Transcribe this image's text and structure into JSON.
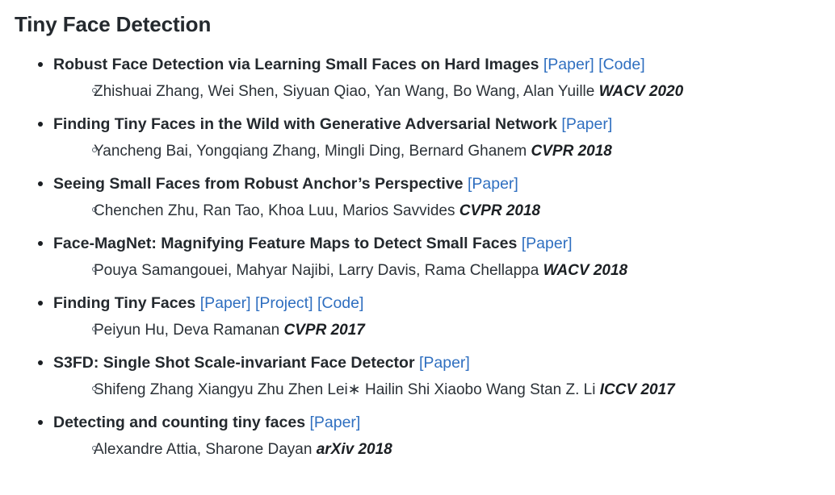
{
  "heading": "Tiny Face Detection",
  "colors": {
    "link": "#2f6fc0",
    "text": "#24292e",
    "background": "#ffffff"
  },
  "entries": [
    {
      "title": "Robust Face Detection via Learning Small Faces on Hard Images",
      "links": [
        {
          "label": "[Paper]"
        },
        {
          "label": "[Code]"
        }
      ],
      "authors": "Zhishuai Zhang, Wei Shen, Siyuan Qiao, Yan Wang, Bo Wang, Alan Yuille",
      "venue": "WACV 2020"
    },
    {
      "title": "Finding Tiny Faces in the Wild with Generative Adversarial Network",
      "links": [
        {
          "label": "[Paper]"
        }
      ],
      "authors": "Yancheng Bai, Yongqiang Zhang, Mingli Ding, Bernard Ghanem",
      "venue": "CVPR 2018"
    },
    {
      "title": "Seeing Small Faces from Robust Anchor’s Perspective",
      "links": [
        {
          "label": "[Paper]"
        }
      ],
      "authors": "Chenchen Zhu, Ran Tao, Khoa Luu, Marios Savvides",
      "venue": "CVPR 2018"
    },
    {
      "title": "Face-MagNet: Magnifying Feature Maps to Detect Small Faces",
      "links": [
        {
          "label": "[Paper]"
        }
      ],
      "authors": "Pouya Samangouei, Mahyar Najibi, Larry Davis, Rama Chellappa",
      "venue": "WACV 2018"
    },
    {
      "title": "Finding Tiny Faces",
      "links": [
        {
          "label": "[Paper]"
        },
        {
          "label": "[Project]"
        },
        {
          "label": "[Code]"
        }
      ],
      "authors": "Peiyun Hu, Deva Ramanan",
      "venue": "CVPR 2017"
    },
    {
      "title": "S3FD: Single Shot Scale-invariant Face Detector",
      "links": [
        {
          "label": "[Paper]"
        }
      ],
      "authors": "Shifeng Zhang Xiangyu Zhu Zhen Lei∗ Hailin Shi Xiaobo Wang Stan Z. Li",
      "venue": "ICCV 2017"
    },
    {
      "title": "Detecting and counting tiny faces",
      "links": [
        {
          "label": "[Paper]"
        }
      ],
      "authors": "Alexandre Attia, Sharone Dayan",
      "venue": "arXiv 2018"
    }
  ]
}
